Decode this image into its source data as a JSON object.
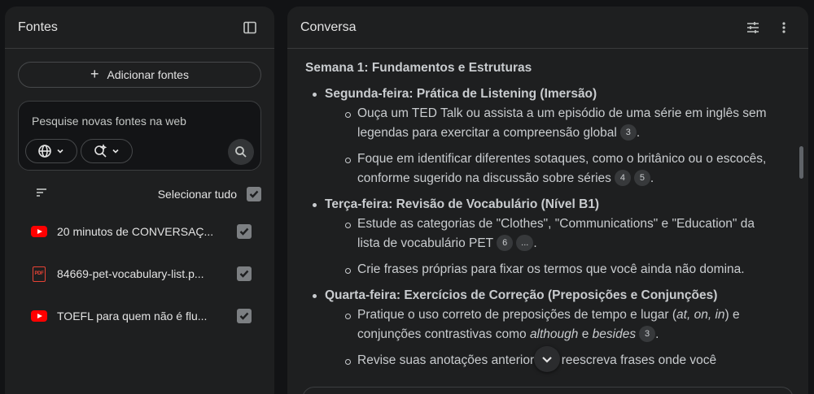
{
  "sources_panel": {
    "title": "Fontes",
    "add_button": "Adicionar fontes",
    "search_placeholder": "Pesquise novas fontes na web",
    "select_all": "Selecionar tudo",
    "items": [
      {
        "name": "20 minutos de CONVERSAÇ...",
        "type": "youtube",
        "checked": true
      },
      {
        "name": "84669-pet-vocabulary-list.p...",
        "type": "pdf",
        "checked": true
      },
      {
        "name": "TOEFL para quem não é flu...",
        "type": "youtube",
        "checked": true
      }
    ],
    "pdf_label": "PDF"
  },
  "chat_panel": {
    "title": "Conversa",
    "heading": "Semana 1: Fundamentos e Estruturas",
    "days": [
      {
        "title": "Segunda-feira: Prática de Listening (Imersão)",
        "bullets": [
          {
            "text": "Ouça um TED Talk ou assista a um episódio de uma série em inglês sem legendas para exercitar a compreensão global",
            "citations": [
              "3"
            ],
            "end": "."
          },
          {
            "text": "Foque em identificar diferentes sotaques, como o britânico ou o escocês, conforme sugerido na discussão sobre séries",
            "citations": [
              "4",
              "5"
            ],
            "end": "."
          }
        ]
      },
      {
        "title": "Terça-feira: Revisão de Vocabulário (Nível B1)",
        "bullets": [
          {
            "text": "Estude as categorias de \"Clothes\", \"Communications\" e \"Education\" da lista de vocabulário PET",
            "citations": [
              "6",
              "..."
            ],
            "end": "."
          },
          {
            "text": "Crie frases próprias para fixar os termos que você ainda não domina.",
            "citations": [],
            "end": ""
          }
        ]
      },
      {
        "title": "Quarta-feira: Exercícios de Correção (Preposições e Conjunções)",
        "bullets": [
          {
            "text_parts": [
              "Pratique o uso correto de preposições de tempo e lugar (",
              "at, on, in",
              ") e conjunções contrastivas como ",
              "although",
              " e ",
              "besides"
            ],
            "citations": [
              "3"
            ],
            "end": "."
          },
          {
            "text": "Revise suas anotações anteriores e reescreva frases onde você",
            "citations": [],
            "end": ""
          }
        ]
      }
    ]
  }
}
